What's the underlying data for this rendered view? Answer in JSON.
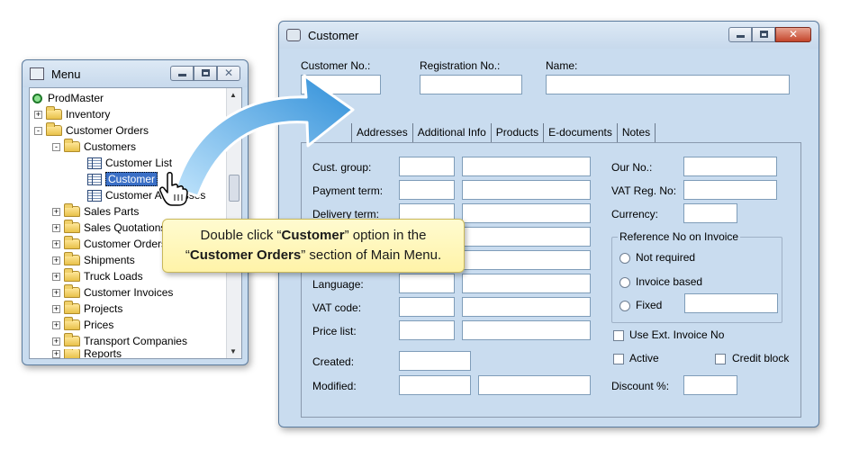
{
  "menu_window": {
    "title": "Menu",
    "tree": [
      {
        "label": "ProdMaster",
        "icon": "root-icon"
      },
      {
        "label": "Inventory",
        "icon": "folder-icon",
        "expander": "+"
      },
      {
        "label": "Customer Orders",
        "icon": "open-folder-icon",
        "expander": "-"
      },
      {
        "label": "Customers",
        "icon": "open-folder-icon",
        "expander": "-"
      },
      {
        "label": "Customer List",
        "icon": "table-icon"
      },
      {
        "label": "Customer",
        "icon": "form-icon",
        "selected": true
      },
      {
        "label": "Customer Addresses",
        "icon": "table-icon"
      },
      {
        "label": "Sales Parts",
        "icon": "folder-icon",
        "expander": "+"
      },
      {
        "label": "Sales Quotations",
        "icon": "folder-icon",
        "expander": "+"
      },
      {
        "label": "Customer Orders",
        "icon": "folder-icon",
        "expander": "+"
      },
      {
        "label": "Shipments",
        "icon": "folder-icon",
        "expander": "+"
      },
      {
        "label": "Truck Loads",
        "icon": "folder-icon",
        "expander": "+"
      },
      {
        "label": "Customer Invoices",
        "icon": "folder-icon",
        "expander": "+"
      },
      {
        "label": "Projects",
        "icon": "folder-icon",
        "expander": "+"
      },
      {
        "label": "Prices",
        "icon": "folder-icon",
        "expander": "+"
      },
      {
        "label": "Transport Companies",
        "icon": "folder-icon",
        "expander": "+"
      },
      {
        "label": "Reports",
        "icon": "folder-icon",
        "expander": "+"
      }
    ]
  },
  "customer_window": {
    "title": "Customer",
    "header_fields": {
      "customer_no": {
        "label": "Customer No.:",
        "value": ""
      },
      "registration_no": {
        "label": "Registration No.:",
        "value": ""
      },
      "name": {
        "label": "Name:",
        "value": ""
      }
    },
    "tabs": [
      "Addresses",
      "Additional Info",
      "Products",
      "E-documents",
      "Notes"
    ],
    "left_fields": [
      "Cust. group:",
      "Payment term:",
      "Delivery term:",
      "",
      "",
      "Language:",
      "VAT code:",
      "Price list:"
    ],
    "created_label": "Created:",
    "modified_label": "Modified:",
    "right_fields": {
      "our_no": "Our No.:",
      "vat_reg_no": "VAT Reg. No:",
      "currency": "Currency:"
    },
    "reference_group": {
      "title": "Reference No on Invoice",
      "options": [
        "Not required",
        "Invoice based",
        "Fixed"
      ]
    },
    "checkboxes": {
      "use_ext_invoice": "Use Ext. Invoice No",
      "active": "Active",
      "credit_block": "Credit block"
    },
    "discount_label": "Discount %:"
  },
  "callout": {
    "line1_prefix": "Double click “",
    "line1_bold": "Customer",
    "line1_suffix": "” option in the",
    "line2_prefix": "“",
    "line2_bold": "Customer Orders",
    "line2_suffix": "” section of Main Menu."
  },
  "colors": {
    "window_bg": "#c9dcef",
    "selection": "#3a6fc6",
    "arrow": "#3aa0e6",
    "callout_bg": "#fff3a8"
  }
}
